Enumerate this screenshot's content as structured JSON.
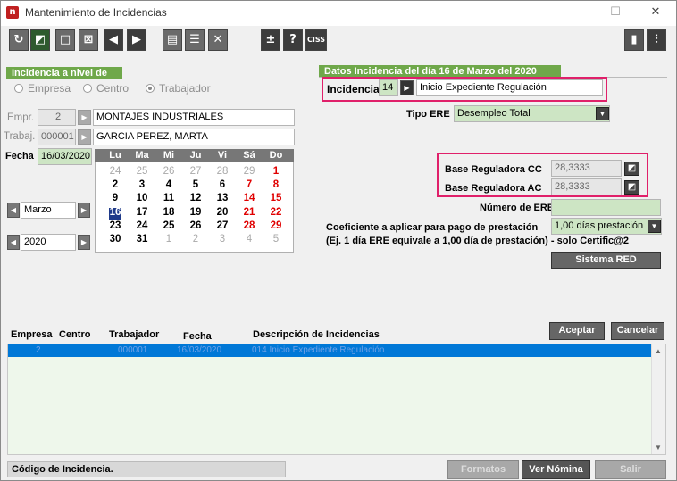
{
  "window": {
    "title": "Mantenimiento de Incidencias",
    "minimize": "—",
    "maximize": "☐",
    "close": "✕"
  },
  "toolbar": {
    "plus_minus": "±",
    "help": "?",
    "ciss": "CISS"
  },
  "left_group": {
    "title": "Incidencia a nivel de",
    "radios": [
      "Empresa",
      "Centro",
      "Trabajador"
    ],
    "selected": "Trabajador",
    "empr_label": "Empr.",
    "empr_value": "2",
    "empr_name": "MONTAJES INDUSTRIALES",
    "trabaj_label": "Trabaj.",
    "trabaj_value": "000001",
    "trabaj_name": "GARCIA PEREZ, MARTA",
    "fecha_label": "Fecha",
    "fecha_value": "16/03/2020",
    "month": "Marzo",
    "year": "2020"
  },
  "calendar": {
    "days_header": [
      "Lu",
      "Ma",
      "Mi",
      "Ju",
      "Vi",
      "Sá",
      "Do"
    ],
    "weeks": [
      [
        "24",
        "25",
        "26",
        "27",
        "28",
        "29",
        "1"
      ],
      [
        "2",
        "3",
        "4",
        "5",
        "6",
        "7",
        "8"
      ],
      [
        "9",
        "10",
        "11",
        "12",
        "13",
        "14",
        "15"
      ],
      [
        "16",
        "17",
        "18",
        "19",
        "20",
        "21",
        "22"
      ],
      [
        "23",
        "24",
        "25",
        "26",
        "27",
        "28",
        "29"
      ],
      [
        "30",
        "31",
        "1",
        "2",
        "3",
        "4",
        "5"
      ]
    ],
    "selected": "16"
  },
  "right_group": {
    "title": "Datos Incidencia del día 16 de Marzo del 2020",
    "incidencia_label": "Incidencia",
    "incidencia_code": "14",
    "incidencia_desc": "Inicio Expediente Regulación",
    "tipo_ere_label": "Tipo ERE",
    "tipo_ere_value": "Desempleo Total",
    "base_cc_label": "Base Reguladora CC",
    "base_cc_value": "28,3333",
    "base_ac_label": "Base Reguladora AC",
    "base_ac_value": "28,3333",
    "numero_ere_label": "Número de ERE",
    "numero_ere_value": "",
    "coef_label": "Coeficiente a aplicar para pago de prestación",
    "coef_value": "1,00 días prestación",
    "note": "(Ej. 1 día ERE equivale a 1,00 día de prestación) - solo Certific@2",
    "sistema_red": "Sistema RED"
  },
  "buttons": {
    "aceptar": "Aceptar",
    "cancelar": "Cancelar",
    "formatos": "Formatos",
    "ver_nomina": "Ver Nómina",
    "salir": "Salir"
  },
  "table": {
    "headers": [
      "Empresa",
      "Centro",
      "Trabajador",
      "Fecha",
      "Descripción de Incidencias"
    ],
    "row": [
      "2",
      "",
      "000001",
      "16/03/2020",
      "014 Inicio Expediente Regulación"
    ]
  },
  "status": "Código de Incidencia."
}
